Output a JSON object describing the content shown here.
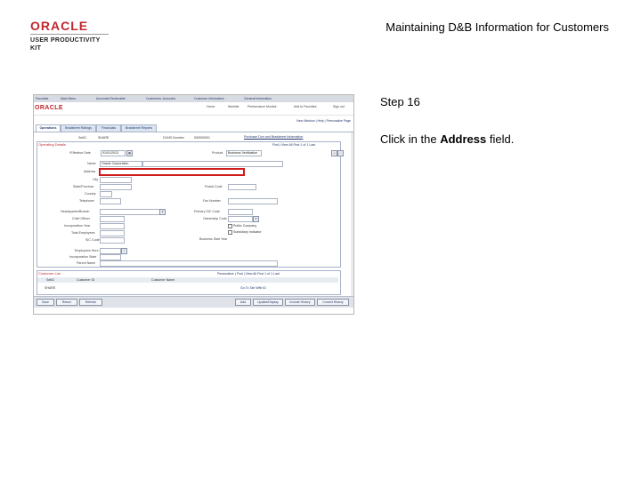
{
  "header": {
    "logo_line1": "ORACLE",
    "logo_line2": "USER PRODUCTIVITY KIT",
    "doc_title": "Maintaining D&B Information for Customers"
  },
  "instruction": {
    "step_label": "Step 16",
    "text_before": "Click in the ",
    "text_bold": "Address",
    "text_after": " field."
  },
  "screenshot": {
    "crumbs": [
      "Favorites",
      "Main Menu",
      "Accounts Receivable",
      "Customers: Accounts",
      "Customer Information",
      "General Information"
    ],
    "brand": "ORACLE",
    "navlinks": [
      "Home",
      "Worklist",
      "Performance Monitor",
      "Add to Favorites",
      "Sign out"
    ],
    "pagelinks": "New Window | Help | Personalize Page",
    "tabs": [
      "Operations",
      "Bradstreet Ratings",
      "Financials",
      "Bradstreet Reports"
    ],
    "top_fields": {
      "setid_label": "SetID",
      "setid_value": "SHARE",
      "duns_label": "DUNS Number",
      "duns_value": "000000001",
      "link": "Purchase Dun and Bradstreet Information",
      "section": "Operating Details",
      "nav": "Find | View All   First  1 of 1  Last",
      "effdate_label": "*Effective Date",
      "effdate_value": "01/01/2013",
      "product_label": "Product",
      "product_value": "Business Verification"
    },
    "left_labels": [
      "Name",
      "Address",
      "City",
      "State/Province",
      "Country",
      "Telephone"
    ],
    "name_value": "Oracle Corporation",
    "right_labels": [
      "Postal Code",
      "Fax Number"
    ],
    "mid_labels": [
      "Headquarter/Branch",
      "Chief Officer",
      "Incorporation Year",
      "Total Employees",
      "SIC Code"
    ],
    "mid_right_labels": [
      "Primary SIC Code",
      "Ownership Code",
      "Public Company",
      "Subsidiary Indicator",
      "Business Start Year"
    ],
    "low_labels": [
      "Employees Here",
      "Incorporation State",
      "Parent Name"
    ],
    "grid": {
      "title": "Customer List",
      "nav": "Personalize | Find | View All   First  1 of 1  Last",
      "col1": "SetID",
      "col2": "Customer ID",
      "col3": "Customer Name",
      "row_col1": "SHARE",
      "row_col3": "Go To Tab With ID"
    },
    "bottom_buttons_left": [
      "Save",
      "Return",
      "Refresh"
    ],
    "bottom_buttons_right": [
      "Add",
      "Update/Display",
      "Include History",
      "Correct History"
    ]
  },
  "colors": {
    "brand_red": "#c0282e",
    "highlight_red": "#d11a1a",
    "link_blue": "#23356b"
  }
}
